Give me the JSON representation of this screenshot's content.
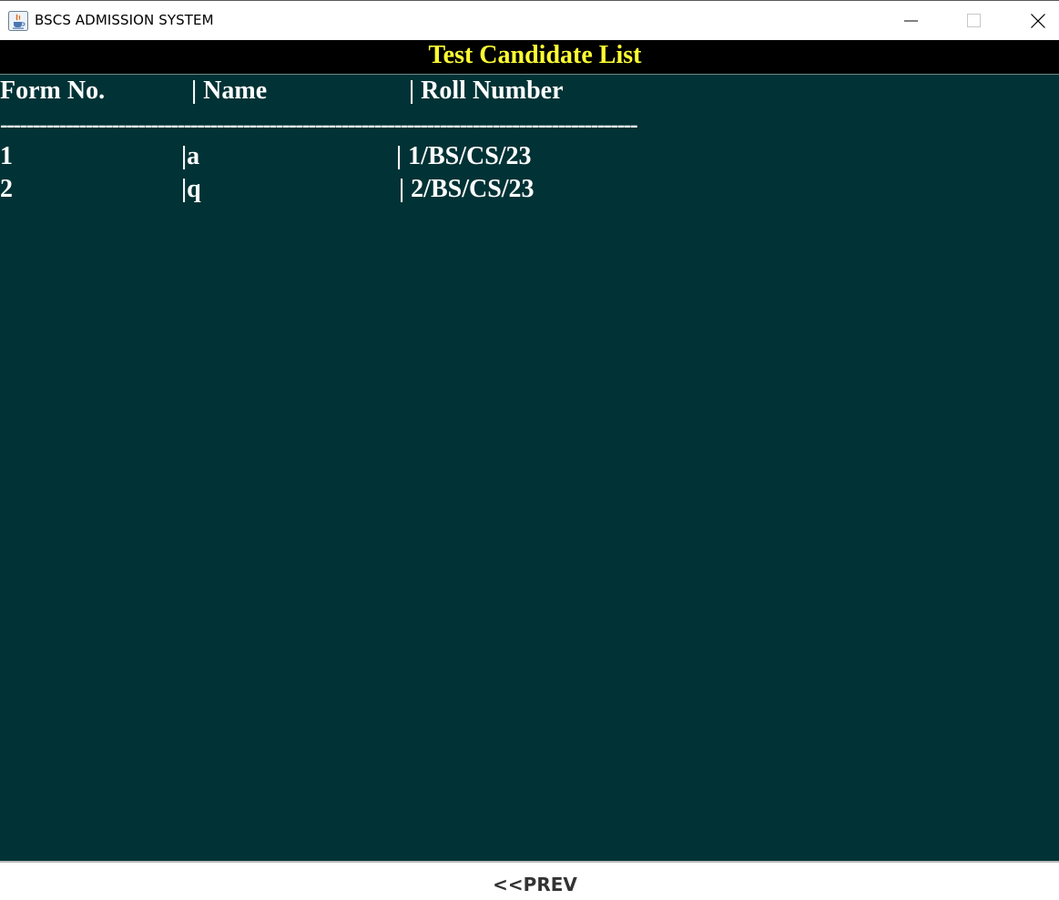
{
  "window": {
    "title": "BSCS ADMISSION SYSTEM",
    "app_icon": "java-cup-icon",
    "controls": {
      "minimize": "minimize-icon",
      "maximize": "maximize-icon",
      "close": "close-icon"
    }
  },
  "header": {
    "title": "Test Candidate List"
  },
  "list": {
    "columns": [
      "Form No.",
      "| Name",
      "| Roll Number"
    ],
    "divider": "-------------------------------------------------------------------------------------------------",
    "rows": [
      [
        "1",
        "|a",
        "| 1/BS/CS/23"
      ],
      [
        "2",
        "|q",
        "| 2/BS/CS/23"
      ]
    ]
  },
  "footer": {
    "prev_label": "<<PREV"
  },
  "colors": {
    "content_bg": "#013235",
    "header_bg": "#000000",
    "header_text": "#ffff33",
    "list_text": "#ffffff"
  }
}
